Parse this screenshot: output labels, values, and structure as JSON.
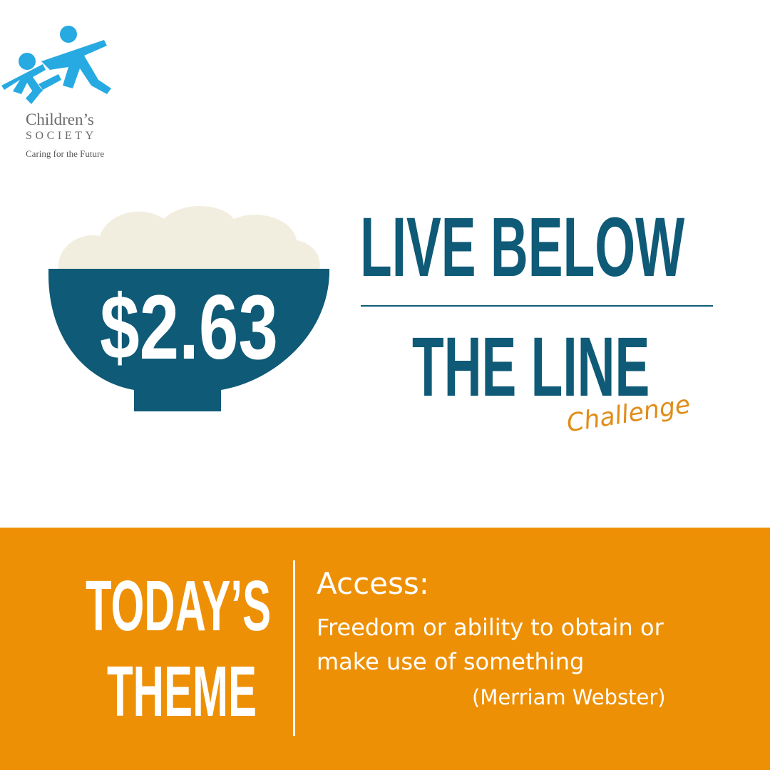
{
  "logo": {
    "name": "Children’s",
    "society": "SOCIETY",
    "tagline": "Caring for the Future"
  },
  "bowl": {
    "price": "$2.63"
  },
  "headline": {
    "line1": "LIVE BELOW",
    "line2": "THE LINE",
    "script": "Challenge"
  },
  "theme": {
    "label_line1": "TODAY’S",
    "label_line2": "THEME",
    "term": "Access:",
    "definition": "Freedom or ability to obtain or make use of something",
    "source": "(Merriam Webster)"
  },
  "colors": {
    "brand_blue": "#0f5a76",
    "logo_cyan": "#27a9e1",
    "accent_orange": "#ee9005",
    "rice_cream": "#f2eedf",
    "challenge_orange": "#e08d1a"
  }
}
